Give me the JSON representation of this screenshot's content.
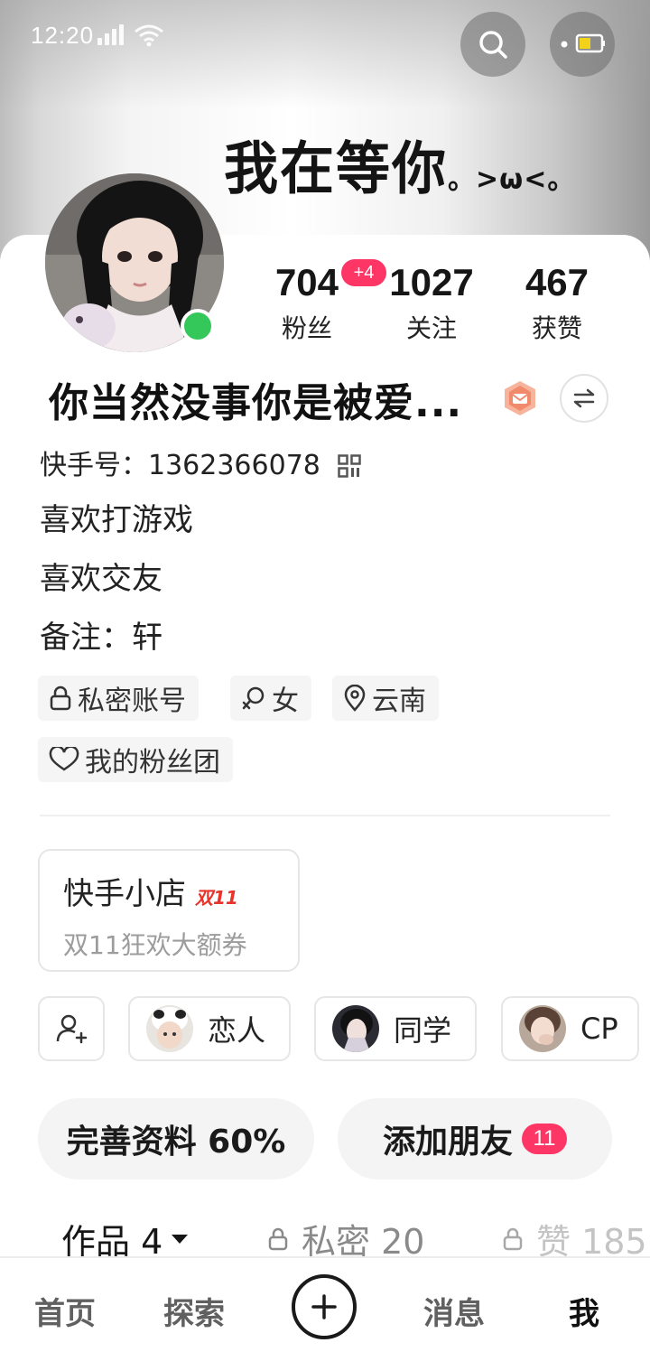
{
  "status_bar": {
    "time": "12:20"
  },
  "banner": {
    "text": "我在等你",
    "tail": "。>ω<。"
  },
  "stats": [
    {
      "value": "704",
      "label": "粉丝"
    },
    {
      "value": "1027",
      "label": "关注"
    },
    {
      "value": "467",
      "label": "获赞"
    }
  ],
  "followers_new_badge": "+4",
  "profile": {
    "nickname": "你当然没事你是被爱...",
    "id_line": "快手号：1362366078",
    "bio_lines": [
      "喜欢打游戏",
      "喜欢交友",
      "备注：轩"
    ]
  },
  "chips": {
    "private_account": "私密账号",
    "gender": "女",
    "location": "云南",
    "fan_group": "我的粉丝团"
  },
  "shop": {
    "title": "快手小店",
    "promo_tag": "双11",
    "subtitle": "双11狂欢大额券"
  },
  "relations": [
    {
      "label": "恋人"
    },
    {
      "label": "同学"
    },
    {
      "label": "CP"
    }
  ],
  "actions": {
    "complete_profile": "完善资料 60%",
    "add_friends": "添加朋友",
    "add_friends_count": "11"
  },
  "content_tabs": {
    "works": "作品 4",
    "private": "私密 20",
    "likes": "赞 185"
  },
  "bottom_nav": [
    "首页",
    "探索",
    "消息",
    "我"
  ],
  "colors": {
    "accent_red": "#fe3666",
    "online_green": "#34c759"
  }
}
